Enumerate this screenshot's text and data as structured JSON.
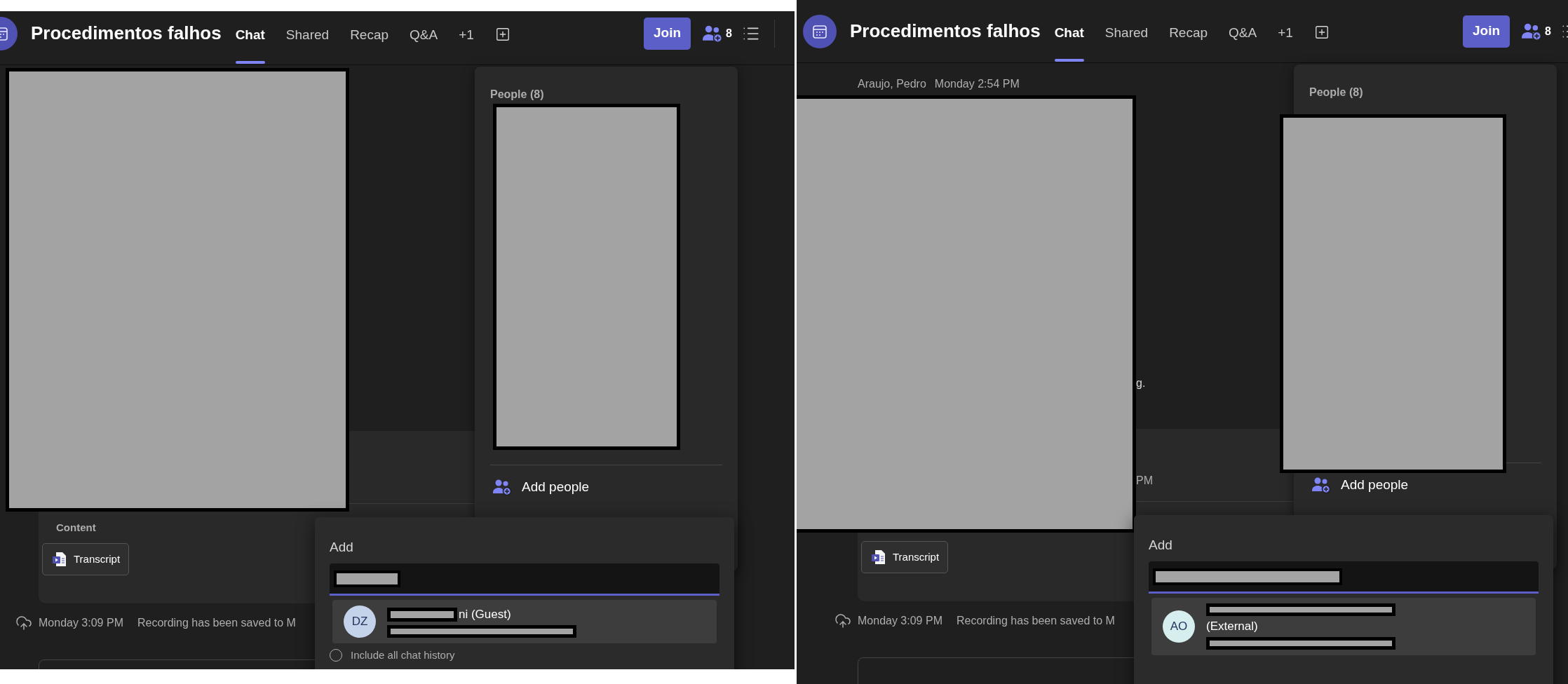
{
  "panels": [
    {
      "header": {
        "title": "Procedimentos falhos",
        "tabs": [
          {
            "label": "Chat",
            "selected": true
          },
          {
            "label": "Shared",
            "selected": false
          },
          {
            "label": "Recap",
            "selected": false
          },
          {
            "label": "Q&A",
            "selected": false
          },
          {
            "label": "+1",
            "selected": false
          }
        ],
        "join": "Join",
        "people_count": "8"
      },
      "content_card": {
        "heading": "Content",
        "attachment": "Transcript"
      },
      "event": {
        "time": "Monday 3:09 PM",
        "text": "Recording has been saved to M"
      },
      "people_panel": {
        "heading": "People (8)",
        "action": "Add people"
      },
      "add_dialog": {
        "title": "Add",
        "result": {
          "initials": "DZ",
          "color": "#c5d3ea",
          "lines": [
            {
              "kind": "masked_text",
              "text": "ni (Guest)"
            },
            {
              "kind": "redacted"
            }
          ]
        },
        "include_history": {
          "label": "Include all chat history",
          "checked": false
        }
      }
    },
    {
      "header": {
        "title": "Procedimentos falhos",
        "tabs": [
          {
            "label": "Chat",
            "selected": true
          },
          {
            "label": "Shared",
            "selected": false
          },
          {
            "label": "Recap",
            "selected": false
          },
          {
            "label": "Q&A",
            "selected": false
          },
          {
            "label": "+1",
            "selected": false
          }
        ],
        "join": "Join",
        "people_count": "8"
      },
      "chat": {
        "author": "Araujo, Pedro",
        "time": "Monday 2:54 PM",
        "message_tail": "g."
      },
      "content_card": {
        "meta_tail": "PM",
        "attachment": "Transcript"
      },
      "event": {
        "time": "Monday 3:09 PM",
        "text": "Recording has been saved to M"
      },
      "people_panel": {
        "heading": "People (8)",
        "action": "Add people"
      },
      "add_dialog": {
        "title": "Add",
        "result": {
          "initials": "AO",
          "color": "#d6eeee",
          "lines": [
            {
              "kind": "redacted"
            },
            {
              "kind": "text",
              "text": "(External)"
            },
            {
              "kind": "redacted"
            }
          ]
        }
      }
    }
  ]
}
